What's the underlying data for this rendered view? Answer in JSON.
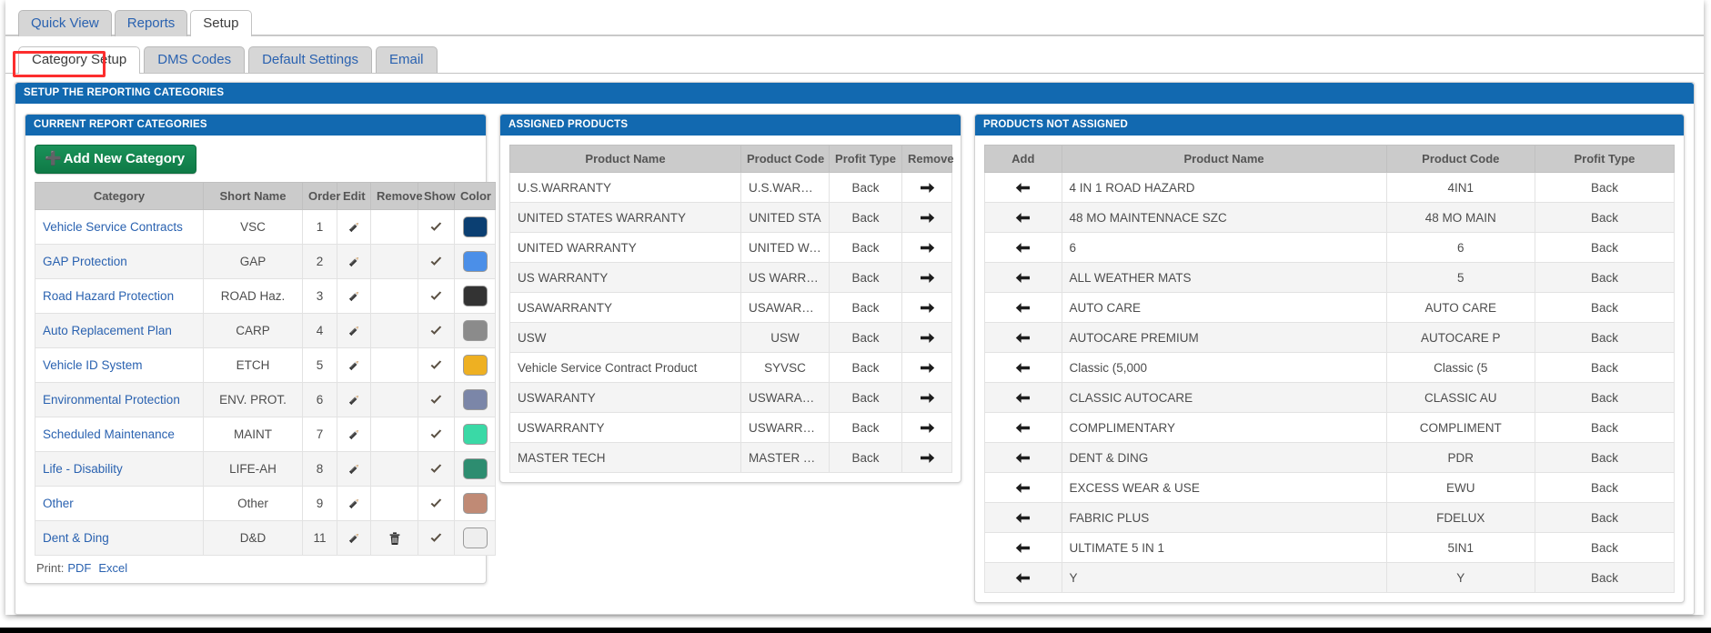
{
  "tabs": [
    {
      "label": "Quick View",
      "active": false
    },
    {
      "label": "Reports",
      "active": false
    },
    {
      "label": "Setup",
      "active": true
    }
  ],
  "subtabs": [
    {
      "label": "Category Setup",
      "active": true,
      "highlighted": true
    },
    {
      "label": "DMS Codes",
      "active": false
    },
    {
      "label": "Default Settings",
      "active": false
    },
    {
      "label": "Email",
      "active": false
    }
  ],
  "outer_panel": {
    "title": "SETUP THE REPORTING CATEGORIES"
  },
  "colors": {
    "panel_header_bg": "#1269b0",
    "add_button_bg": "#14874f",
    "link_blue": "#2a62b0",
    "highlight_border": "#fc2e2e"
  },
  "current_categories": {
    "title": "CURRENT REPORT CATEGORIES",
    "add_button_label": "Add New Category",
    "add_button_icon": "plus-icon",
    "columns": [
      "Category",
      "Short Name",
      "Order",
      "Edit",
      "Remove",
      "Show",
      "Color"
    ],
    "rows": [
      {
        "category": "Vehicle Service Contracts",
        "short_name": "VSC",
        "order": "1",
        "edit": "pencil-icon",
        "remove": "",
        "show": "check-icon",
        "color": "#0b3f72"
      },
      {
        "category": "GAP Protection",
        "short_name": "GAP",
        "order": "2",
        "edit": "pencil-icon",
        "remove": "",
        "show": "check-icon",
        "color": "#4b8fe8"
      },
      {
        "category": "Road Hazard Protection",
        "short_name": "ROAD Haz.",
        "order": "3",
        "edit": "pencil-icon",
        "remove": "",
        "show": "check-icon",
        "color": "#333333"
      },
      {
        "category": "Auto Replacement Plan",
        "short_name": "CARP",
        "order": "4",
        "edit": "pencil-icon",
        "remove": "",
        "show": "check-icon",
        "color": "#8b8b8b"
      },
      {
        "category": "Vehicle ID System",
        "short_name": "ETCH",
        "order": "5",
        "edit": "pencil-icon",
        "remove": "",
        "show": "check-icon",
        "color": "#eeb022"
      },
      {
        "category": "Environmental Protection",
        "short_name": "ENV. PROT.",
        "order": "6",
        "edit": "pencil-icon",
        "remove": "",
        "show": "check-icon",
        "color": "#7b86a8"
      },
      {
        "category": "Scheduled Maintenance",
        "short_name": "MAINT",
        "order": "7",
        "edit": "pencil-icon",
        "remove": "",
        "show": "check-icon",
        "color": "#3ad9a6"
      },
      {
        "category": "Life - Disability",
        "short_name": "LIFE-AH",
        "order": "8",
        "edit": "pencil-icon",
        "remove": "",
        "show": "check-icon",
        "color": "#2d8d70"
      },
      {
        "category": "Other",
        "short_name": "Other",
        "order": "9",
        "edit": "pencil-icon",
        "remove": "",
        "show": "check-icon",
        "color": "#c08a75"
      },
      {
        "category": "Dent & Ding",
        "short_name": "D&D",
        "order": "11",
        "edit": "pencil-icon",
        "remove": "trash-icon",
        "show": "check-icon",
        "color": "#eeeeee"
      }
    ],
    "print_label": "Print:",
    "print_links": [
      "PDF",
      "Excel"
    ]
  },
  "assigned_products": {
    "title": "ASSIGNED PRODUCTS",
    "columns": [
      "Product Name",
      "Product Code",
      "Profit Type",
      "Remove"
    ],
    "remove_icon": "arrow-right-icon",
    "rows": [
      {
        "name": "U.S.WARRANTY",
        "code": "U.S.WARRAN",
        "profit_type": "Back"
      },
      {
        "name": "UNITED STATES WARRANTY",
        "code": "UNITED STA",
        "profit_type": "Back"
      },
      {
        "name": "UNITED WARRANTY",
        "code": "UNITED WAR",
        "profit_type": "Back"
      },
      {
        "name": "US WARRANTY",
        "code": "US WARRANT",
        "profit_type": "Back"
      },
      {
        "name": "USAWARRANTY",
        "code": "USAWARRANT",
        "profit_type": "Back"
      },
      {
        "name": "USW",
        "code": "USW",
        "profit_type": "Back"
      },
      {
        "name": "Vehicle Service Contract Product",
        "code": "SYVSC",
        "profit_type": "Back"
      },
      {
        "name": "USWARANTY",
        "code": "USWARANTY",
        "profit_type": "Back"
      },
      {
        "name": "USWARRANTY",
        "code": "USWARRANTY",
        "profit_type": "Back"
      },
      {
        "name": "MASTER TECH",
        "code": "MASTER TEC",
        "profit_type": "Back"
      }
    ]
  },
  "products_not_assigned": {
    "title": "PRODUCTS NOT ASSIGNED",
    "columns": [
      "Add",
      "Product Name",
      "Product Code",
      "Profit Type"
    ],
    "add_icon": "arrow-left-icon",
    "rows": [
      {
        "name": "4 IN 1 ROAD HAZARD",
        "code": "4IN1",
        "profit_type": "Back"
      },
      {
        "name": "48 MO MAINTENNACE SZC",
        "code": "48 MO MAIN",
        "profit_type": "Back"
      },
      {
        "name": "6",
        "code": "6",
        "profit_type": "Back"
      },
      {
        "name": "ALL WEATHER MATS",
        "code": "5",
        "profit_type": "Back"
      },
      {
        "name": "AUTO CARE",
        "code": "AUTO CARE",
        "profit_type": "Back"
      },
      {
        "name": "AUTOCARE PREMIUM",
        "code": "AUTOCARE P",
        "profit_type": "Back"
      },
      {
        "name": "Classic (5,000",
        "code": "Classic (5",
        "profit_type": "Back"
      },
      {
        "name": "CLASSIC AUTOCARE",
        "code": "CLASSIC AU",
        "profit_type": "Back"
      },
      {
        "name": "COMPLIMENTARY",
        "code": "COMPLIMENT",
        "profit_type": "Back"
      },
      {
        "name": "DENT & DING",
        "code": "PDR",
        "profit_type": "Back"
      },
      {
        "name": "EXCESS WEAR & USE",
        "code": "EWU",
        "profit_type": "Back"
      },
      {
        "name": "FABRIC PLUS",
        "code": "FDELUX",
        "profit_type": "Back"
      },
      {
        "name": "ULTIMATE 5 IN 1",
        "code": "5IN1",
        "profit_type": "Back"
      },
      {
        "name": "Y",
        "code": "Y",
        "profit_type": "Back"
      }
    ]
  }
}
